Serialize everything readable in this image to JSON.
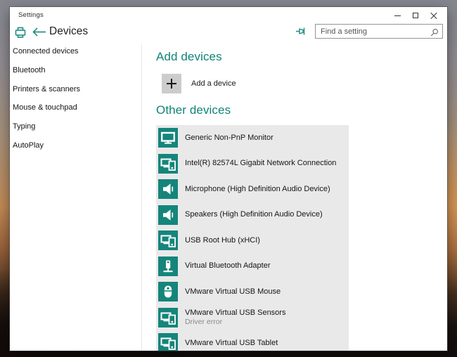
{
  "colors": {
    "accent": "#0E8476",
    "tile_background": "#15857B",
    "panel_background": "#e9e9e9",
    "plus_button_background": "#cccccc",
    "status_text": "#8a8a8a"
  },
  "window": {
    "title": "Settings"
  },
  "header": {
    "title": "Devices"
  },
  "search": {
    "placeholder": "Find a setting"
  },
  "sidebar": {
    "items": [
      {
        "label": "Connected devices"
      },
      {
        "label": "Bluetooth"
      },
      {
        "label": "Printers & scanners"
      },
      {
        "label": "Mouse & touchpad"
      },
      {
        "label": "Typing"
      },
      {
        "label": "AutoPlay"
      }
    ]
  },
  "main": {
    "add_section": {
      "title": "Add devices",
      "button_label": "Add a device"
    },
    "other_section": {
      "title": "Other devices",
      "devices": [
        {
          "name": "Generic Non-PnP Monitor",
          "icon": "monitor"
        },
        {
          "name": "Intel(R) 82574L Gigabit Network Connection",
          "icon": "devices"
        },
        {
          "name": "Microphone (High Definition Audio Device)",
          "icon": "speaker"
        },
        {
          "name": "Speakers (High Definition Audio Device)",
          "icon": "speaker"
        },
        {
          "name": "USB Root Hub (xHCI)",
          "icon": "devices"
        },
        {
          "name": "Virtual Bluetooth Adapter",
          "icon": "usb-adapter"
        },
        {
          "name": "VMware Virtual USB Mouse",
          "icon": "mouse"
        },
        {
          "name": "VMware Virtual USB Sensors",
          "icon": "devices",
          "status": "Driver error"
        },
        {
          "name": "VMware Virtual USB Tablet",
          "icon": "devices"
        }
      ]
    }
  }
}
